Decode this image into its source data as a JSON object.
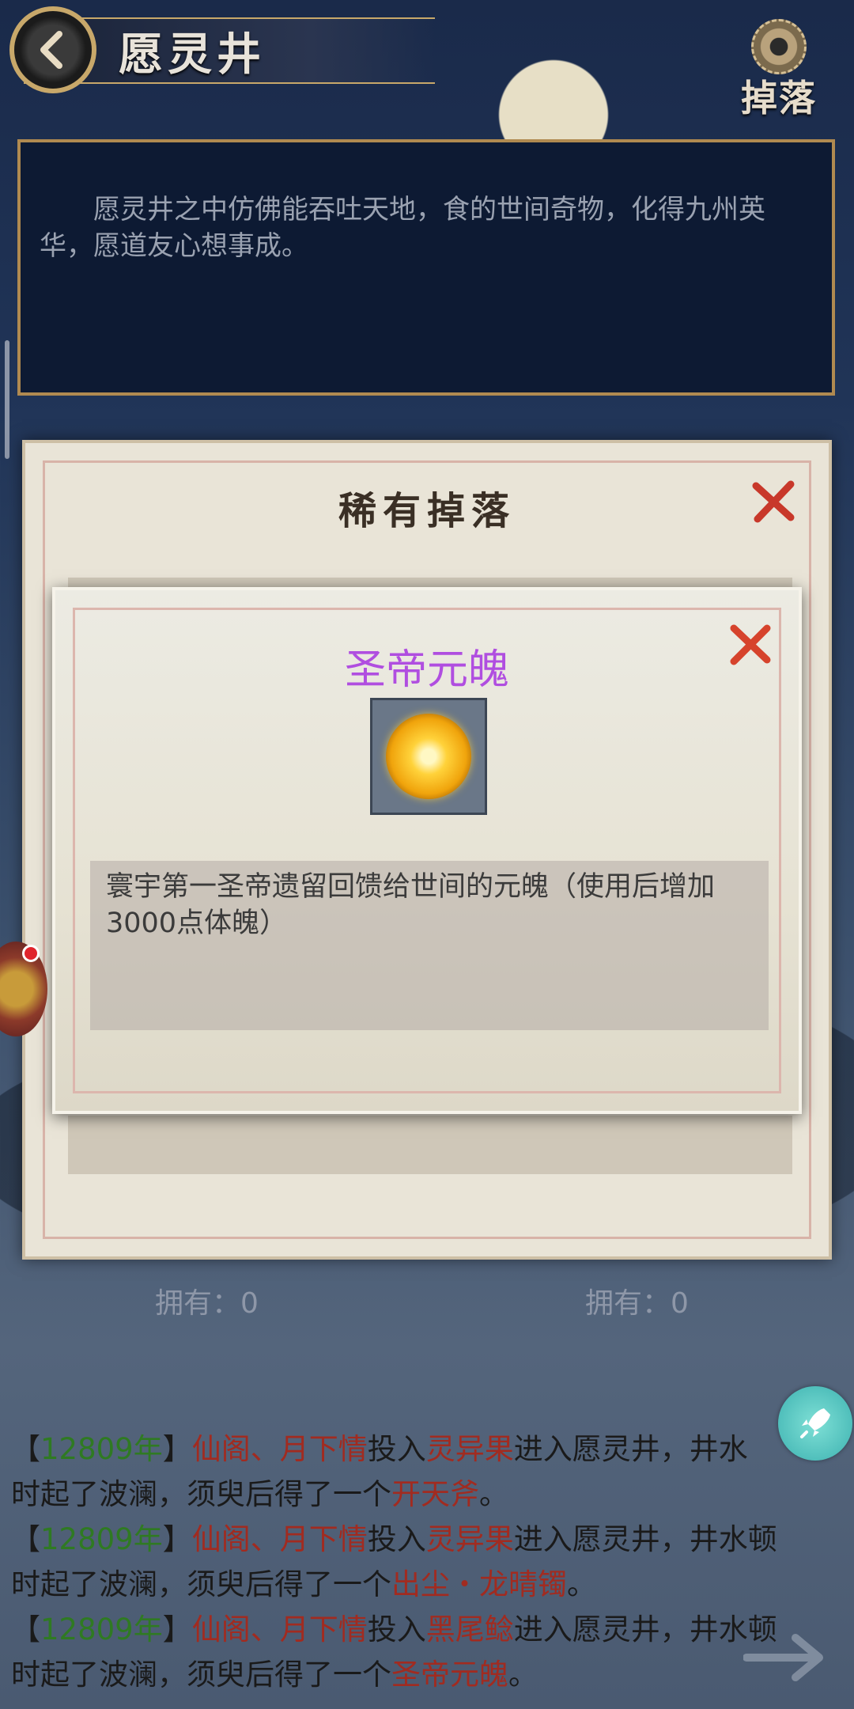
{
  "header": {
    "title": "愿灵井",
    "drop_button_label": "掉落"
  },
  "description": "愿灵井之中仿佛能吞吐天地，食的世间奇物，化得九州英华，愿道友心想事成。",
  "rare_drop_dialog": {
    "title": "稀有掉落",
    "owned_left": "拥有：0",
    "owned_right": "拥有：0"
  },
  "item_dialog": {
    "name": "圣帝元魄",
    "description": "寰宇第一圣帝遗留回馈给世间的元魄（使用后增加3000点体魄）",
    "name_color": "#b04ee0"
  },
  "log": [
    {
      "open": "【",
      "year": "12809年",
      "close": "】",
      "players": "仙阁、月下情",
      "verb1": "投入",
      "input": "灵异果",
      "text1": "进入愿灵井，井水",
      "line2a": "时起了波澜，须臾后得了一个",
      "output": "开天斧",
      "end": "。"
    },
    {
      "open": "【",
      "year": "12809年",
      "close": "】",
      "players": "仙阁、月下情",
      "verb1": "投入",
      "input": "灵异果",
      "text1": "进入愿灵井，井水顿",
      "line2a": "时起了波澜，须臾后得了一个",
      "output": "出尘・龙晴镯",
      "end": "。"
    },
    {
      "open": "【",
      "year": "12809年",
      "close": "】",
      "players": "仙阁、月下情",
      "verb1": "投入",
      "input": "黑尾鲶",
      "text1": "进入愿灵井，井水顿",
      "line2a": "时起了波澜，须臾后得了一个",
      "output": "圣帝元魄",
      "end": "。"
    }
  ],
  "icons": [
    "back-arrow-icon",
    "gear-icon",
    "close-x-icon",
    "gold-orb-icon",
    "treasure-chest-icon",
    "rocket-icon",
    "arrow-right-icon"
  ]
}
